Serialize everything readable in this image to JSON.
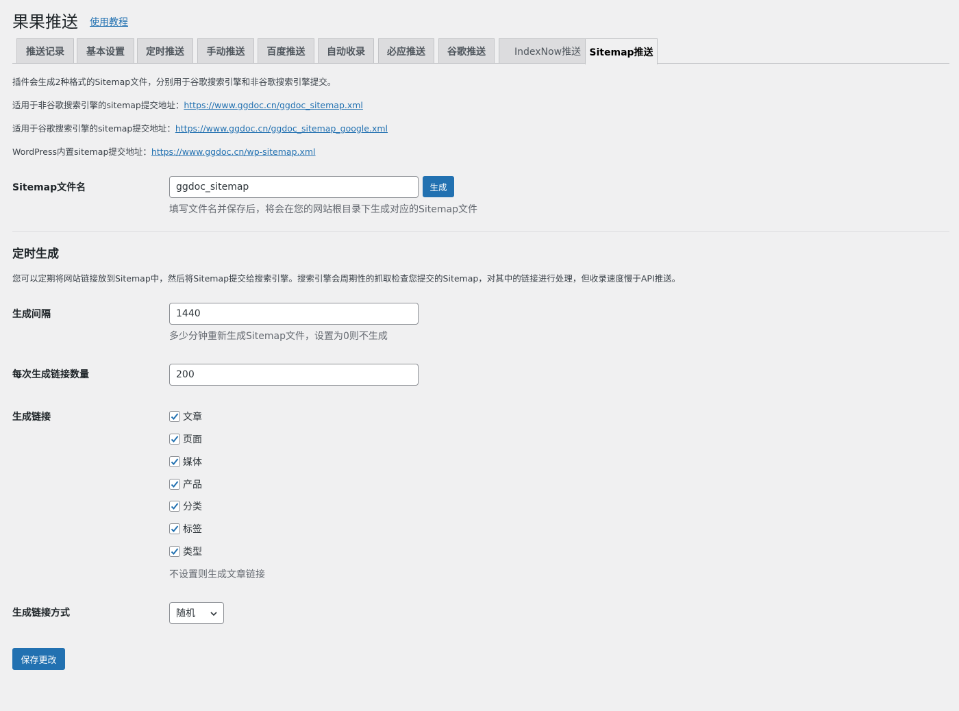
{
  "header": {
    "title": "果果推送",
    "tutorial_link": "使用教程"
  },
  "tabs": [
    {
      "label": "推送记录",
      "active": false
    },
    {
      "label": "基本设置",
      "active": false
    },
    {
      "label": "定时推送",
      "active": false
    },
    {
      "label": "手动推送",
      "active": false
    },
    {
      "label": "百度推送",
      "active": false
    },
    {
      "label": "自动收录",
      "active": false
    },
    {
      "label": "必应推送",
      "active": false
    },
    {
      "label": "谷歌推送",
      "active": false
    },
    {
      "label": "IndexNow推送",
      "active": false
    },
    {
      "label": "Sitemap推送",
      "active": true
    }
  ],
  "info": {
    "line1": "插件会生成2种格式的Sitemap文件，分别用于谷歌搜索引擎和非谷歌搜索引擎提交。",
    "line2_label": "适用于非谷歌搜索引擎的sitemap提交地址：",
    "line2_url": "https://www.ggdoc.cn/ggdoc_sitemap.xml",
    "line3_label": "适用于谷歌搜索引擎的sitemap提交地址：",
    "line3_url": "https://www.ggdoc.cn/ggdoc_sitemap_google.xml",
    "line4_label": "WordPress内置sitemap提交地址：",
    "line4_url": "https://www.ggdoc.cn/wp-sitemap.xml"
  },
  "sitemap_name": {
    "label": "Sitemap文件名",
    "value": "ggdoc_sitemap",
    "generate_button": "生成",
    "description": "填写文件名并保存后，将会在您的网站根目录下生成对应的Sitemap文件"
  },
  "scheduled": {
    "title": "定时生成",
    "description": "您可以定期将网站链接放到Sitemap中，然后将Sitemap提交给搜索引擎。搜索引擎会周期性的抓取检查您提交的Sitemap，对其中的链接进行处理，但收录速度慢于API推送。",
    "interval": {
      "label": "生成间隔",
      "value": "1440",
      "description": "多少分钟重新生成Sitemap文件，设置为0则不生成"
    },
    "count": {
      "label": "每次生成链接数量",
      "value": "200"
    },
    "links": {
      "label": "生成链接",
      "options": [
        {
          "label": "文章",
          "checked": true
        },
        {
          "label": "页面",
          "checked": true
        },
        {
          "label": "媒体",
          "checked": true
        },
        {
          "label": "产品",
          "checked": true
        },
        {
          "label": "分类",
          "checked": true
        },
        {
          "label": "标签",
          "checked": true
        },
        {
          "label": "类型",
          "checked": true
        }
      ],
      "description": "不设置则生成文章链接"
    },
    "mode": {
      "label": "生成链接方式",
      "selected": "随机"
    }
  },
  "save_button": "保存更改",
  "colors": {
    "accent": "#2271b1",
    "background": "#f0f0f1"
  }
}
